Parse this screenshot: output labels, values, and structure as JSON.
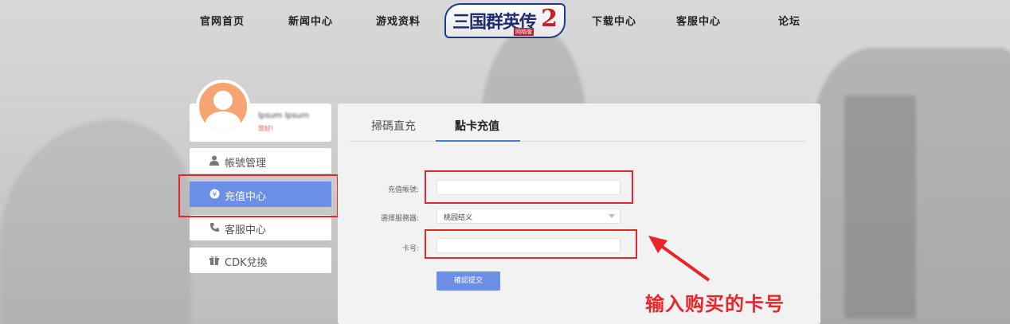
{
  "nav": {
    "items": [
      "官网首页",
      "新闻中心",
      "游戏资料",
      "下载中心",
      "客服中心",
      "论坛"
    ],
    "logo": {
      "title": "三国群英传",
      "number": "2",
      "sub": "网络版"
    }
  },
  "profile": {
    "username": "lpsum lpsum",
    "greeting": "您好!"
  },
  "sidebar": {
    "items": [
      {
        "label": "帳號管理",
        "icon": "user-icon"
      },
      {
        "label": "充值中心",
        "icon": "yen-coin-icon"
      },
      {
        "label": "客服中心",
        "icon": "phone-icon"
      },
      {
        "label": "CDK兌換",
        "icon": "gift-icon"
      }
    ],
    "active_index": 1
  },
  "tabs": {
    "items": [
      "掃碼直充",
      "點卡充值"
    ],
    "active_index": 1
  },
  "form": {
    "account_label": "充值帳號:",
    "account_value": "",
    "server_label": "選擇服務器:",
    "server_value": "桃园结义",
    "card_label": "卡号:",
    "card_value": "",
    "submit_label": "確認提交"
  },
  "annotation": {
    "text": "输入购买的卡号",
    "color": "#e8262a"
  },
  "colors": {
    "accent": "#6b8ee6",
    "tab_underline": "#4f76d8",
    "highlight_red": "#e8262a",
    "avatar": "#f6a474"
  }
}
